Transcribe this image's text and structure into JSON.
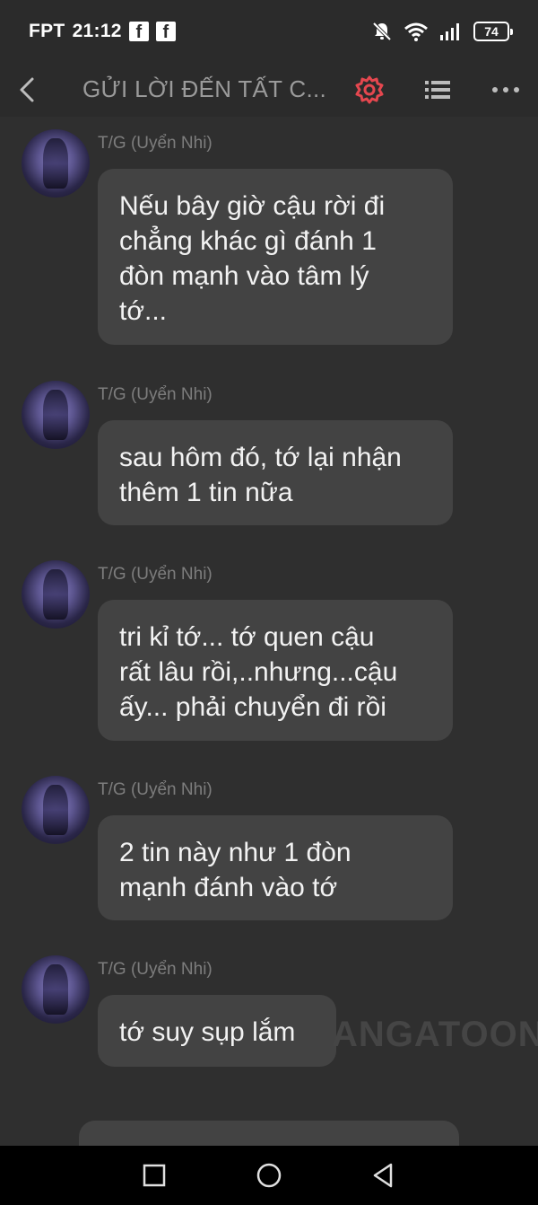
{
  "status_bar": {
    "carrier": "FPT",
    "time": "21:12",
    "app_icons": [
      "facebook-icon",
      "facebook-icon"
    ],
    "battery": "74"
  },
  "header": {
    "title": "GỬI LỜI ĐẾN TẤT C...",
    "accent_color": "#e5474f"
  },
  "messages": [
    {
      "sender": "T/G (Uyển Nhi)",
      "lines": [
        "Nếu bây giờ cậu rời đi",
        "chẳng khác gì đánh 1",
        "đòn mạnh vào tâm lý",
        "tớ..."
      ]
    },
    {
      "sender": "T/G (Uyển Nhi)",
      "lines": [
        "sau hôm đó, tớ lại nhận",
        "thêm 1 tin nữa"
      ]
    },
    {
      "sender": "T/G (Uyển Nhi)",
      "lines": [
        "tri kỉ tớ... tớ quen cậu",
        "rất lâu rồi,..nhưng...cậu",
        "ấy... phải chuyển đi rồi"
      ]
    },
    {
      "sender": "T/G (Uyển Nhi)",
      "lines": [
        "2 tin này như 1 đòn",
        "mạnh đánh vào tớ"
      ]
    },
    {
      "sender": "T/G (Uyển Nhi)",
      "lines": [
        "tớ suy sụp lắm"
      ]
    }
  ],
  "watermark": "ANGATOON"
}
